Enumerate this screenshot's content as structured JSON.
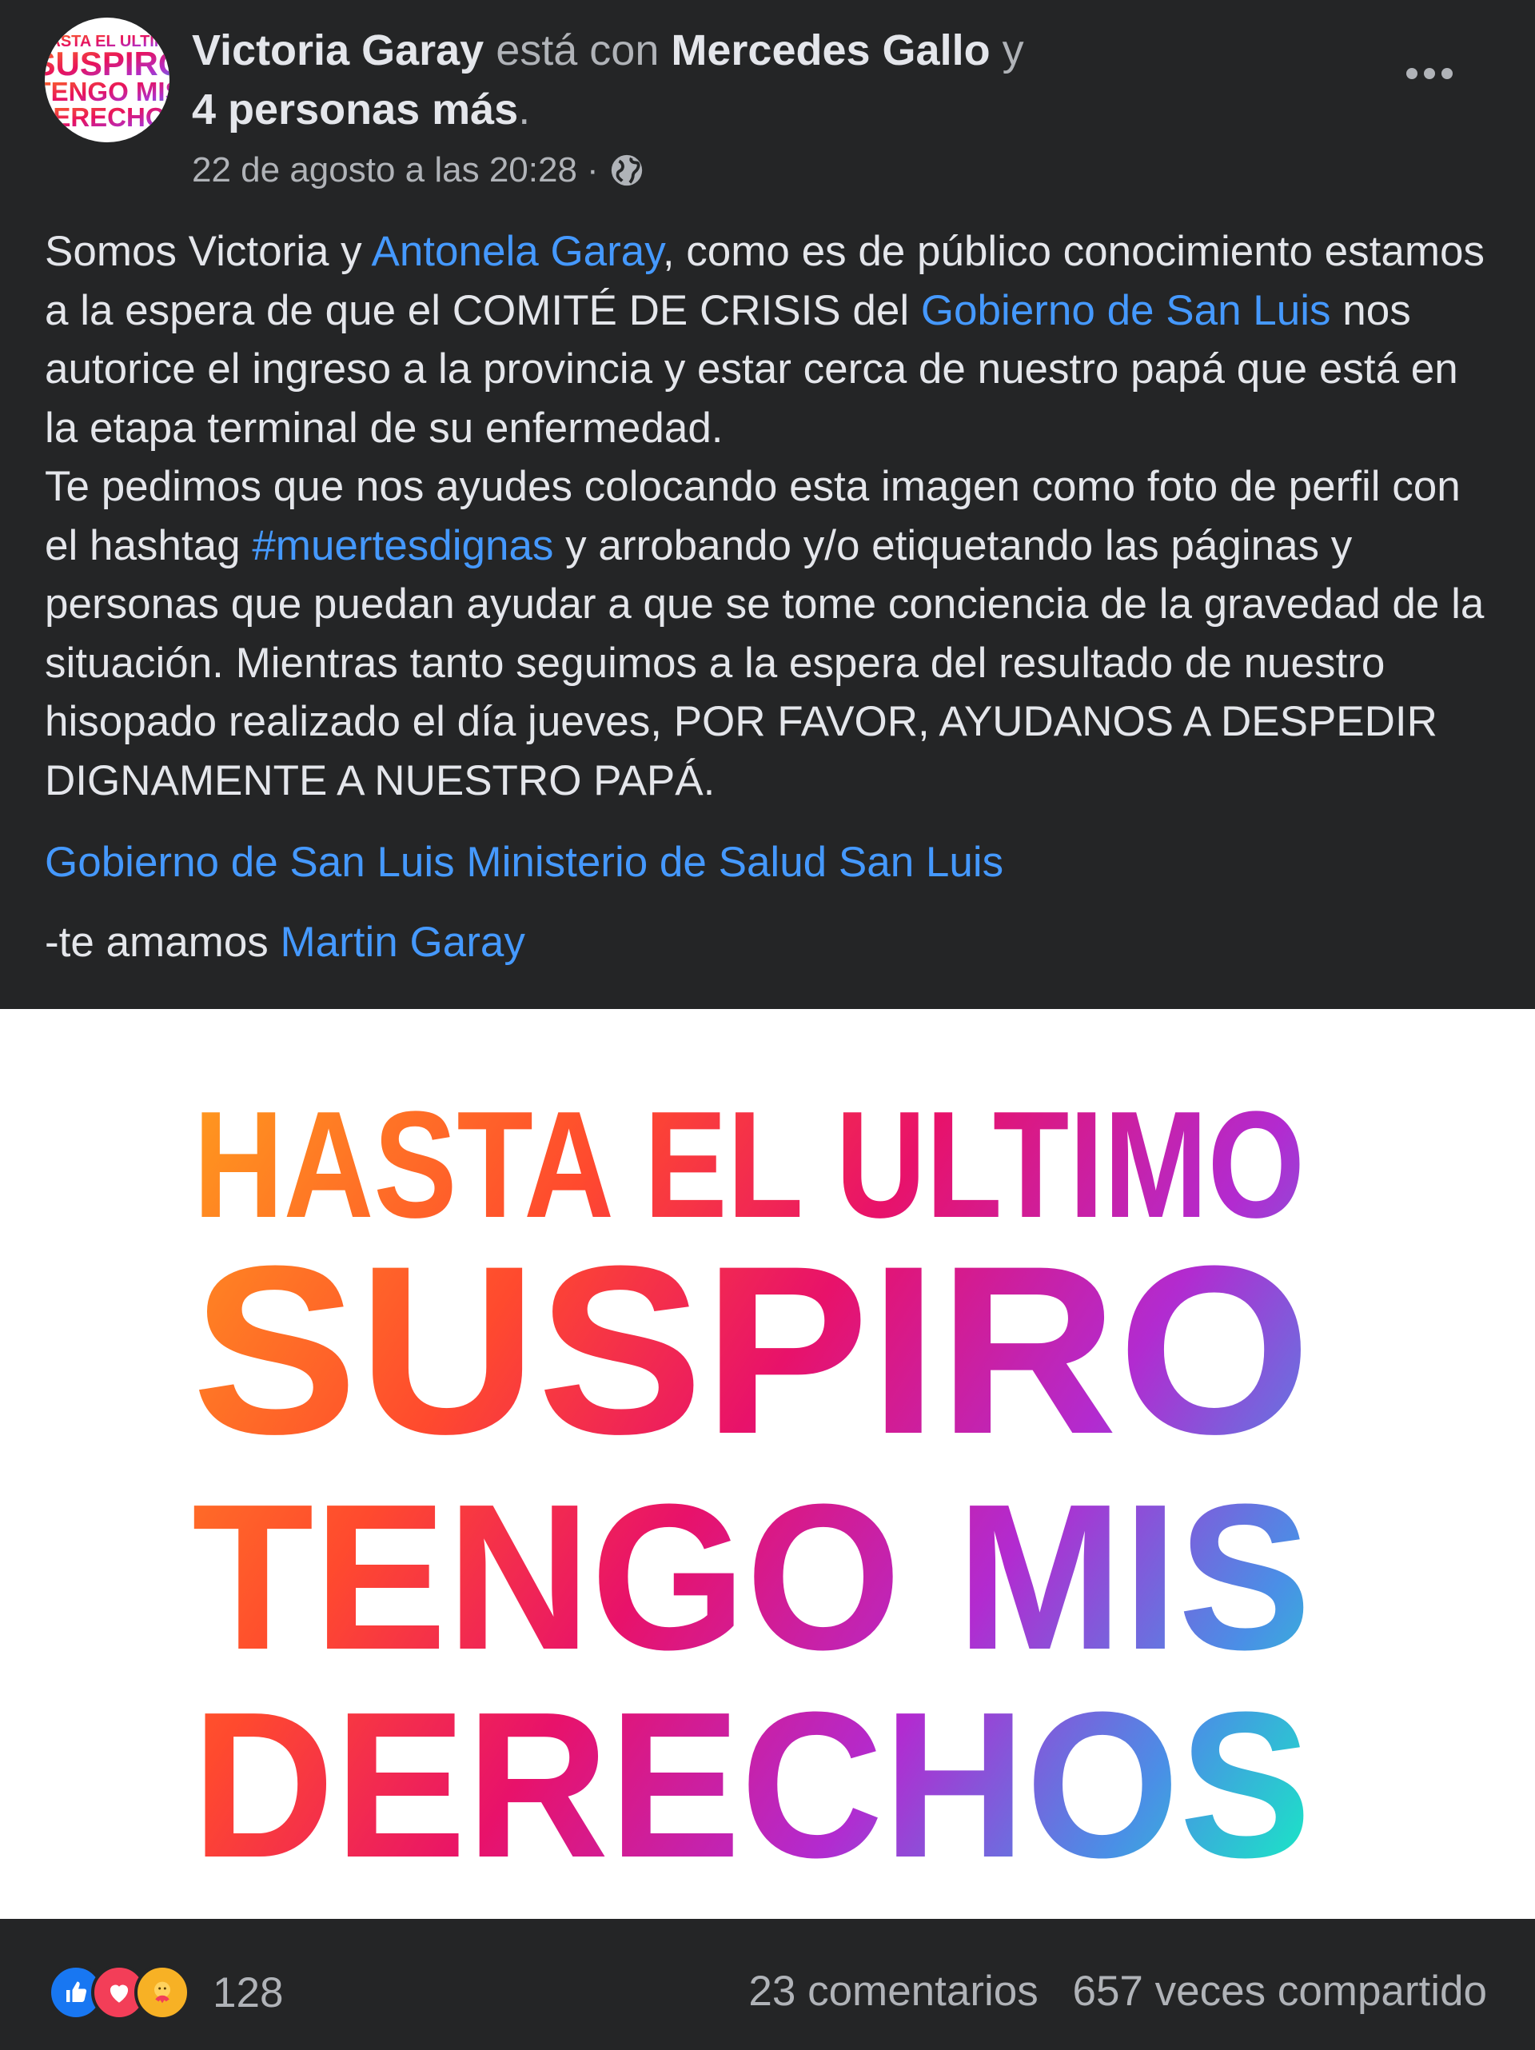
{
  "post": {
    "author": "Victoria Garay",
    "with_text": "está con",
    "tagged_person": "Mercedes Gallo",
    "and_text": "y",
    "others": "4 personas más",
    "period": ".",
    "timestamp": "22 de agosto a las 20:28",
    "separator": "·",
    "privacy_icon": "globe-icon",
    "more_icon": "more-options-icon",
    "avatar_lines": [
      "HASTA EL ULTIMO",
      "SUSPIRO",
      "TENGO MIS",
      "DERECHOS"
    ],
    "text": {
      "s1": "Somos Victoria y ",
      "link1": "Antonela Garay",
      "s2": ", como es de público conocimiento estamos a la espera de que el COMITÉ DE CRISIS del ",
      "link2": "Gobierno de San Luis",
      "s3": " nos autorice el ingreso a la provincia y estar cerca de nuestro papá que está en la etapa terminal de su enfermedad.",
      "s4": "Te pedimos que nos ayudes colocando esta imagen como foto de perfil con el hashtag ",
      "hashtag": "#muertesdignas",
      "s5": " y arrobando y/o etiquetando las páginas y personas que puedan ayudar a que se tome conciencia de la gravedad de la situación. Mientras tanto seguimos a la espera del resultado de nuestro hisopado realizado el día jueves, POR FAVOR, AYUDANOS A DESPEDIR DIGNAMENTE A NUESTRO PAPÁ."
    },
    "tags": {
      "tag1": "Gobierno de San Luis",
      "tag2": "Ministerio de Salud San Luis"
    },
    "closing": {
      "prefix": "-te amamos ",
      "link": "Martin Garay"
    },
    "image_lines": [
      "HASTA EL ULTIMO",
      "SUSPIRO",
      "TENGO MIS",
      "DERECHOS"
    ],
    "reactions": {
      "icons": [
        "like-icon",
        "love-icon",
        "care-icon"
      ],
      "count": "128",
      "comments": "23 comentarios",
      "shares": "657 veces compartido"
    },
    "colors": {
      "background": "#242526",
      "text": "#e4e6eb",
      "secondary": "#b0b3b8",
      "link": "#4599ff",
      "like": "#1877f2",
      "love": "#f33e58",
      "care": "#f7b125"
    }
  }
}
